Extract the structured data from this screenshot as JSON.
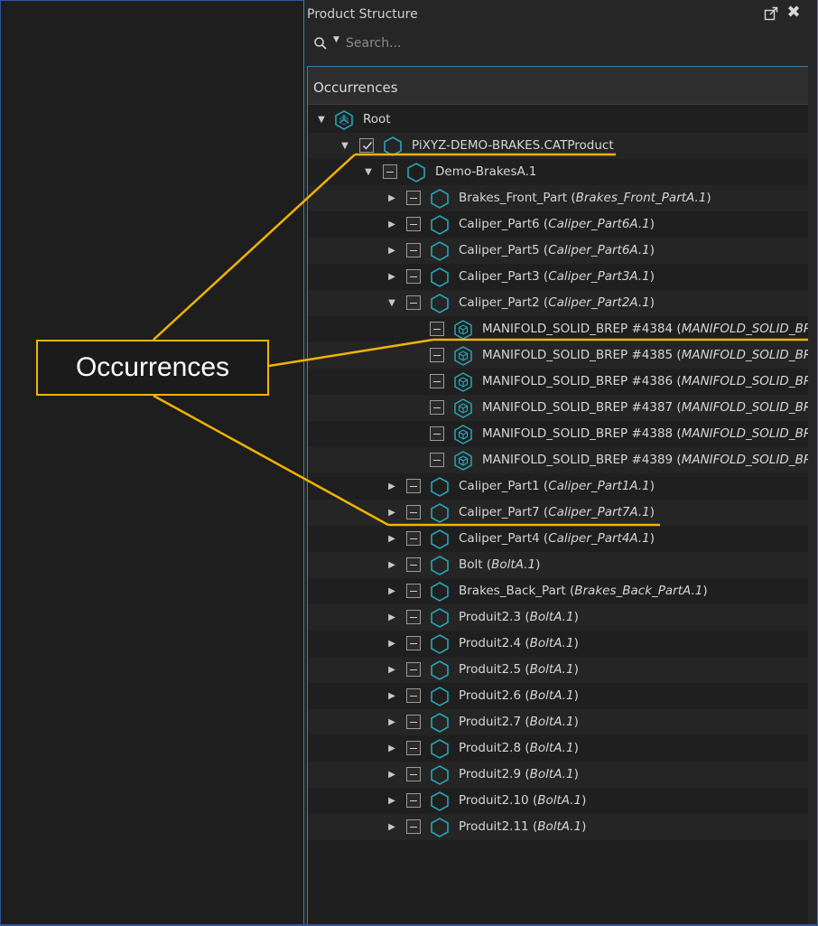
{
  "panel": {
    "title": "Product Structure",
    "popout_icon": "popout-icon",
    "close_icon": "close-icon",
    "search": {
      "placeholder": "Search...",
      "icon": "search-icon"
    },
    "tree_header": "Occurrences"
  },
  "tree": [
    {
      "expander": "expanded",
      "check": "none",
      "icon": "assembly-icon",
      "name": "Root",
      "ref": ""
    },
    {
      "expander": "expanded",
      "check": "checked",
      "icon": "hexagon-icon",
      "name": "PiXYZ-DEMO-BRAKES.CATProduct",
      "ref": ""
    },
    {
      "expander": "expanded",
      "check": "partial",
      "icon": "hexagon-icon",
      "name": "Demo-BrakesA.1",
      "ref": ""
    },
    {
      "expander": "collapsed",
      "check": "partial",
      "icon": "hexagon-icon",
      "name": "Brakes_Front_Part",
      "ref": "Brakes_Front_PartA.1"
    },
    {
      "expander": "collapsed",
      "check": "partial",
      "icon": "hexagon-icon",
      "name": "Caliper_Part6",
      "ref": "Caliper_Part6A.1"
    },
    {
      "expander": "collapsed",
      "check": "partial",
      "icon": "hexagon-icon",
      "name": "Caliper_Part5",
      "ref": "Caliper_Part6A.1"
    },
    {
      "expander": "collapsed",
      "check": "partial",
      "icon": "hexagon-icon",
      "name": "Caliper_Part3",
      "ref": "Caliper_Part3A.1"
    },
    {
      "expander": "expanded",
      "check": "partial",
      "icon": "hexagon-icon",
      "name": "Caliper_Part2",
      "ref": "Caliper_Part2A.1"
    },
    {
      "expander": "none",
      "check": "partial",
      "icon": "cube-icon",
      "name": "MANIFOLD_SOLID_BREP #4384",
      "ref": "MANIFOLD_SOLID_BREP",
      "ref_truncated": true
    },
    {
      "expander": "none",
      "check": "partial",
      "icon": "cube-icon",
      "name": "MANIFOLD_SOLID_BREP #4385",
      "ref": "MANIFOLD_SOLID_BREP",
      "ref_truncated": true
    },
    {
      "expander": "none",
      "check": "partial",
      "icon": "cube-icon",
      "name": "MANIFOLD_SOLID_BREP #4386",
      "ref": "MANIFOLD_SOLID_BREP",
      "ref_truncated": true
    },
    {
      "expander": "none",
      "check": "partial",
      "icon": "cube-icon",
      "name": "MANIFOLD_SOLID_BREP #4387",
      "ref": "MANIFOLD_SOLID_BREP",
      "ref_truncated": true
    },
    {
      "expander": "none",
      "check": "partial",
      "icon": "cube-icon",
      "name": "MANIFOLD_SOLID_BREP #4388",
      "ref": "MANIFOLD_SOLID_BREP",
      "ref_truncated": true
    },
    {
      "expander": "none",
      "check": "partial",
      "icon": "cube-icon",
      "name": "MANIFOLD_SOLID_BREP #4389",
      "ref": "MANIFOLD_SOLID_BREP",
      "ref_truncated": true
    },
    {
      "expander": "collapsed",
      "check": "partial",
      "icon": "hexagon-icon",
      "name": "Caliper_Part1",
      "ref": "Caliper_Part1A.1"
    },
    {
      "expander": "collapsed",
      "check": "partial",
      "icon": "hexagon-icon",
      "name": "Caliper_Part7",
      "ref": "Caliper_Part7A.1"
    },
    {
      "expander": "collapsed",
      "check": "partial",
      "icon": "hexagon-icon",
      "name": "Caliper_Part4",
      "ref": "Caliper_Part4A.1"
    },
    {
      "expander": "collapsed",
      "check": "partial",
      "icon": "hexagon-icon",
      "name": "Bolt",
      "ref": "BoltA.1"
    },
    {
      "expander": "collapsed",
      "check": "partial",
      "icon": "hexagon-icon",
      "name": "Brakes_Back_Part",
      "ref": "Brakes_Back_PartA.1"
    },
    {
      "expander": "collapsed",
      "check": "partial",
      "icon": "hexagon-icon",
      "name": "Produit2.3",
      "ref": "BoltA.1"
    },
    {
      "expander": "collapsed",
      "check": "partial",
      "icon": "hexagon-icon",
      "name": "Produit2.4",
      "ref": "BoltA.1"
    },
    {
      "expander": "collapsed",
      "check": "partial",
      "icon": "hexagon-icon",
      "name": "Produit2.5",
      "ref": "BoltA.1"
    },
    {
      "expander": "collapsed",
      "check": "partial",
      "icon": "hexagon-icon",
      "name": "Produit2.6",
      "ref": "BoltA.1"
    },
    {
      "expander": "collapsed",
      "check": "partial",
      "icon": "hexagon-icon",
      "name": "Produit2.7",
      "ref": "BoltA.1"
    },
    {
      "expander": "collapsed",
      "check": "partial",
      "icon": "hexagon-icon",
      "name": "Produit2.8",
      "ref": "BoltA.1"
    },
    {
      "expander": "collapsed",
      "check": "partial",
      "icon": "hexagon-icon",
      "name": "Produit2.9",
      "ref": "BoltA.1"
    },
    {
      "expander": "collapsed",
      "check": "partial",
      "icon": "hexagon-icon",
      "name": "Produit2.10",
      "ref": "BoltA.1"
    },
    {
      "expander": "collapsed",
      "check": "partial",
      "icon": "hexagon-icon",
      "name": "Produit2.11",
      "ref": "BoltA.1"
    }
  ],
  "callout": {
    "label": "Occurrences",
    "color": "#f2b400"
  },
  "colors": {
    "icon_teal": "#2aa3b5",
    "frame_blue": "#2f5597",
    "panel_border": "#3d7ea0"
  }
}
